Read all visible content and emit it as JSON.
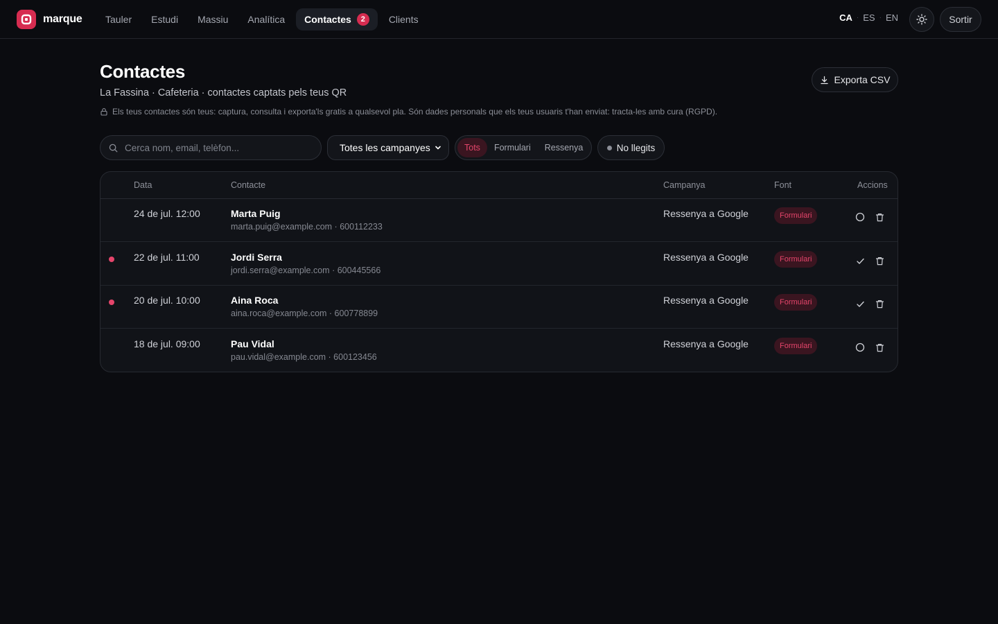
{
  "app": {
    "brand": "marque"
  },
  "nav": {
    "items": [
      {
        "label": "Tauler"
      },
      {
        "label": "Estudi"
      },
      {
        "label": "Massiu"
      },
      {
        "label": "Analítica"
      },
      {
        "label": "Contactes",
        "badge": "2",
        "active": true
      },
      {
        "label": "Clients"
      }
    ]
  },
  "lang": {
    "items": [
      "CA",
      "ES",
      "EN"
    ],
    "active": "CA",
    "separator": "·"
  },
  "header": {
    "logout_label": "Sortir",
    "theme_icon": "sun-icon"
  },
  "page": {
    "title": "Contactes",
    "subtitle": "La Fassina · Cafeteria · contactes captats pels teus QR",
    "notice": "Els teus contactes són teus: captura, consulta i exporta'ls gratis a qualsevol pla. Són dades personals que els teus usuaris t'han enviat: tracta-les amb cura (RGPD).",
    "export_label": "Exporta CSV"
  },
  "filters": {
    "search_placeholder": "Cerca nom, email, telèfon...",
    "campaign_selected": "Totes les campanyes",
    "source_tabs": [
      "Tots",
      "Formulari",
      "Ressenya"
    ],
    "source_active": "Tots",
    "unread_label": "No llegits"
  },
  "table": {
    "columns": [
      "Data",
      "Contacte",
      "Campanya",
      "Font",
      "Accions"
    ],
    "rows": [
      {
        "date": "24 de jul. 12:00",
        "name": "Marta Puig",
        "meta": "marta.puig@example.com · 600112233",
        "campaign": "Ressenya a Google",
        "source": "Formulari",
        "unread": false
      },
      {
        "date": "22 de jul. 11:00",
        "name": "Jordi Serra",
        "meta": "jordi.serra@example.com · 600445566",
        "campaign": "Ressenya a Google",
        "source": "Formulari",
        "unread": true
      },
      {
        "date": "20 de jul. 10:00",
        "name": "Aina Roca",
        "meta": "aina.roca@example.com · 600778899",
        "campaign": "Ressenya a Google",
        "source": "Formulari",
        "unread": true
      },
      {
        "date": "18 de jul. 09:00",
        "name": "Pau Vidal",
        "meta": "pau.vidal@example.com · 600123456",
        "campaign": "Ressenya a Google",
        "source": "Formulari",
        "unread": false
      }
    ]
  },
  "colors": {
    "accent": "#d62c50",
    "accent_text": "#e5456b",
    "background": "#0b0c10"
  }
}
